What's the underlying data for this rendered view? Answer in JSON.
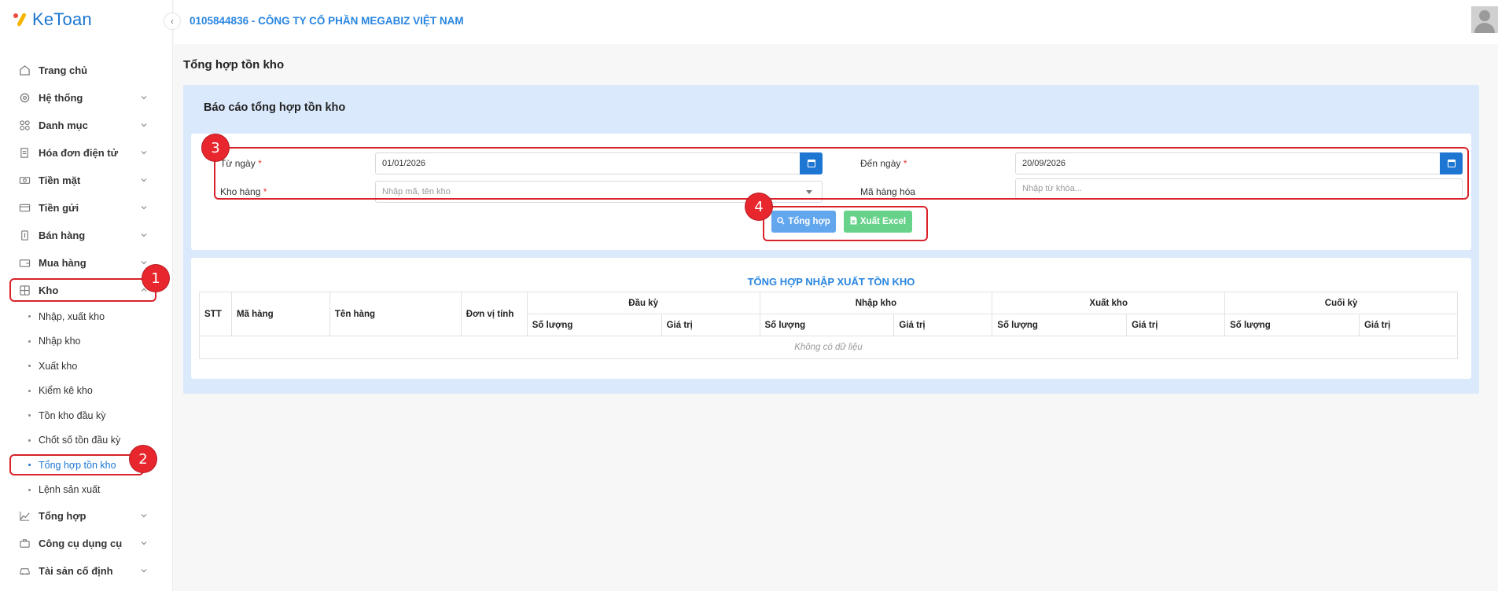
{
  "brand": {
    "name": "KeToan"
  },
  "company": "0105844836 - CÔNG TY CỔ PHẦN MEGABIZ VIỆT NAM",
  "sidebar": {
    "items": [
      {
        "label": "Trang chủ",
        "icon": "home-icon"
      },
      {
        "label": "Hệ thống",
        "icon": "gear-icon"
      },
      {
        "label": "Danh mục",
        "icon": "grid-icon"
      },
      {
        "label": "Hóa đơn điện tử",
        "icon": "invoice-icon"
      },
      {
        "label": "Tiền mặt",
        "icon": "cash-icon"
      },
      {
        "label": "Tiền gửi",
        "icon": "card-icon"
      },
      {
        "label": "Bán hàng",
        "icon": "sale-icon"
      },
      {
        "label": "Mua hàng",
        "icon": "wallet-icon"
      },
      {
        "label": "Kho",
        "icon": "warehouse-icon"
      }
    ],
    "kho_submenu": [
      "Nhập, xuất kho",
      "Nhập kho",
      "Xuất kho",
      "Kiểm kê kho",
      "Tồn kho đầu kỳ",
      "Chốt số tồn đầu kỳ",
      "Tổng hợp tồn kho",
      "Lệnh sản xuất"
    ],
    "items_after": [
      {
        "label": "Tổng hợp",
        "icon": "chart-icon"
      },
      {
        "label": "Công cụ dụng cụ",
        "icon": "tools-icon"
      },
      {
        "label": "Tài sản cố định",
        "icon": "car-icon"
      }
    ]
  },
  "page": {
    "title": "Tổng hợp tồn kho",
    "panel_title": "Báo cáo tổng hợp tồn kho"
  },
  "filters": {
    "from_label": "Từ ngày",
    "from_value": "01/01/2026",
    "to_label": "Đến ngày",
    "to_value": "20/09/2026",
    "warehouse_label": "Kho hàng",
    "warehouse_placeholder": "Nhập mã, tên kho",
    "item_code_label": "Mã hàng hóa",
    "item_code_placeholder": "Nhập từ khóa...",
    "required_mark": "*"
  },
  "buttons": {
    "summarize": "Tổng hợp",
    "export_excel": "Xuất Excel"
  },
  "report": {
    "title": "TỔNG HỢP NHẬP XUẤT TỒN KHO",
    "columns": {
      "stt": "STT",
      "code": "Mã hàng",
      "name": "Tên hàng",
      "unit": "Đơn vị tính",
      "opening": "Đầu kỳ",
      "import": "Nhập kho",
      "export": "Xuất kho",
      "closing": "Cuối kỳ",
      "qty": "Số lượng",
      "value": "Giá trị"
    },
    "empty_text": "Không có dữ liệu"
  },
  "annotations": [
    "1",
    "2",
    "3",
    "4"
  ],
  "colors": {
    "accent": "#1c76d2",
    "annotation": "#e8262d",
    "panel_bg": "#dbe9fc",
    "excel_green": "#67d28a",
    "summarize_blue": "#62a6ee"
  }
}
